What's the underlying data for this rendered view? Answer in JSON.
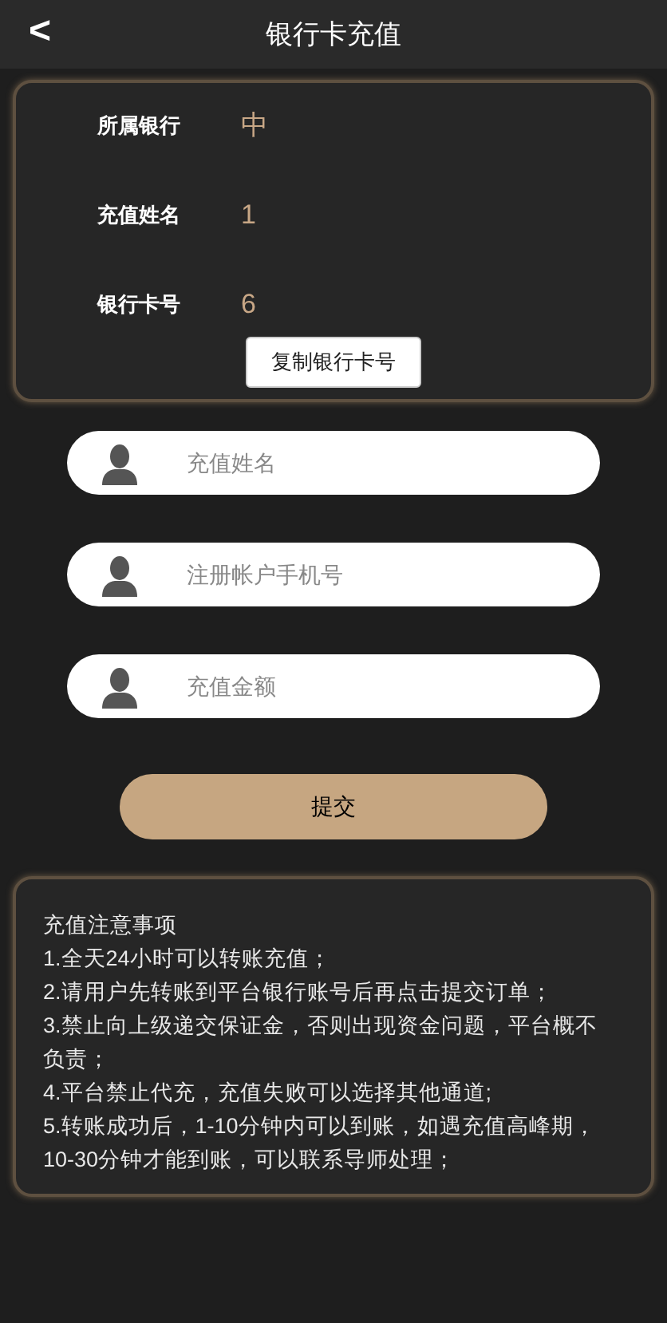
{
  "header": {
    "back": "<",
    "title": "银行卡充值"
  },
  "bank_info": [
    {
      "label": "所属银行",
      "value": "中"
    },
    {
      "label": "充值姓名",
      "value": "1"
    },
    {
      "label": "银行卡号",
      "value": "6"
    }
  ],
  "copy_button": "复制银行卡号",
  "fields": [
    {
      "placeholder": "充值姓名"
    },
    {
      "placeholder": "注册帐户手机号"
    },
    {
      "placeholder": "充值金额"
    }
  ],
  "submit_button": "提交",
  "notes": {
    "title": "充值注意事项",
    "items": [
      "1.全天24小时可以转账充值；",
      "2.请用户先转账到平台银行账号后再点击提交订单；",
      "3.禁止向上级递交保证金，否则出现资金问题，平台概不负责；",
      "4.平台禁止代充，充值失败可以选择其他通道;",
      "5.转账成功后，1-10分钟内可以到账，如遇充值高峰期，10-30分钟才能到账，可以联系导师处理；"
    ]
  }
}
